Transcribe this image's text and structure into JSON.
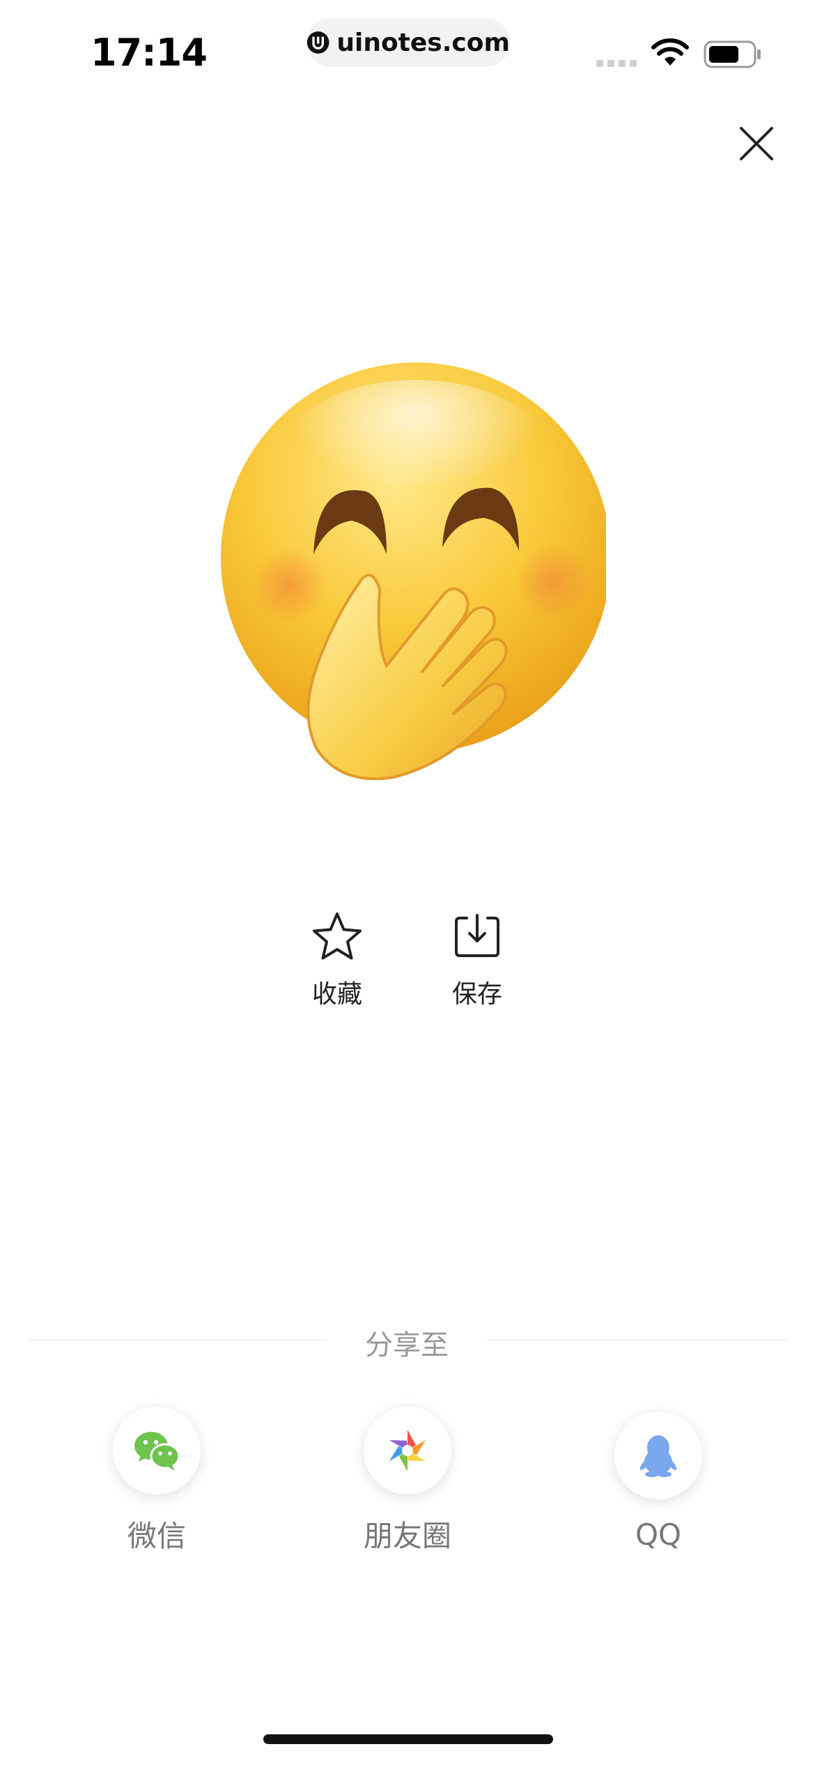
{
  "status_bar": {
    "time": "17:14",
    "url": "uinotes.com"
  },
  "icons": {
    "close": "close-icon",
    "favorite": "star-icon",
    "save": "download-icon",
    "wechat": "wechat-icon",
    "moments": "moments-icon",
    "qq": "qq-penguin-icon"
  },
  "actions": {
    "favorite_label": "收藏",
    "save_label": "保存"
  },
  "share": {
    "title": "分享至",
    "targets": [
      {
        "label": "微信"
      },
      {
        "label": "朋友圈"
      },
      {
        "label": "QQ"
      }
    ]
  },
  "colors": {
    "wechat_green": "#6fc34f",
    "qq_blue": "#7aa8ee",
    "text_primary": "#222222",
    "text_muted": "#999999"
  }
}
